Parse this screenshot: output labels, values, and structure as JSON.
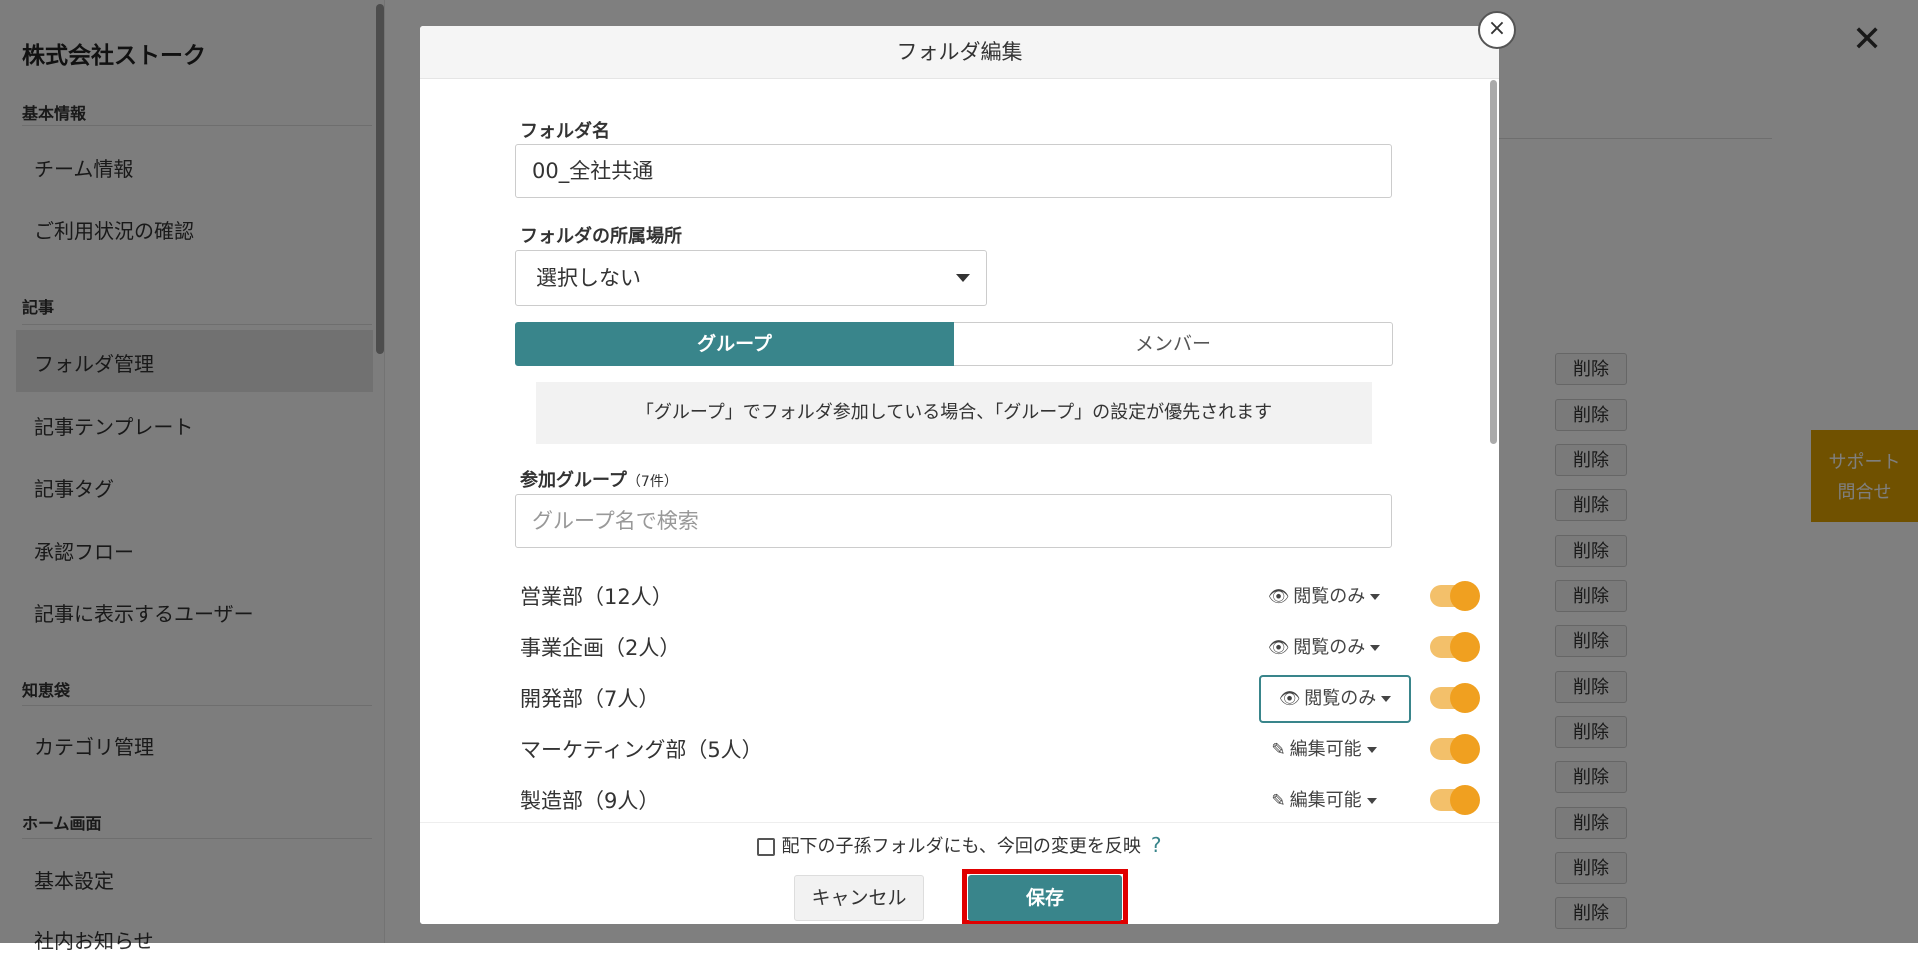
{
  "sidebar": {
    "company": "株式会社ストーク",
    "sections": [
      {
        "heading": "基本情報",
        "items": [
          "チーム情報",
          "ご利用状況の確認"
        ]
      },
      {
        "heading": "記事",
        "items": [
          "フォルダ管理",
          "記事テンプレート",
          "記事タグ",
          "承認フロー",
          "記事に表示するユーザー"
        ]
      },
      {
        "heading": "知恵袋",
        "items": [
          "カテゴリ管理"
        ]
      },
      {
        "heading": "ホーム画面",
        "items": [
          "基本設定",
          "社内お知らせ"
        ]
      }
    ],
    "active_item": "フォルダ管理"
  },
  "background": {
    "close_glyph": "✕",
    "delete_label": "削除",
    "support_line1": "サポート",
    "support_line2": "問合せ"
  },
  "modal": {
    "title": "フォルダ編集",
    "close_glyph": "×",
    "folder_name_label": "フォルダ名",
    "folder_name_value": "00_全社共通",
    "parent_label": "フォルダの所属場所",
    "parent_value": "選択しない",
    "tabs": {
      "group": "グループ",
      "member": "メンバー"
    },
    "notice": "「グループ」でフォルダ参加している場合、「グループ」の設定が優先されます",
    "groups_label": "参加グループ",
    "groups_count": "（7件）",
    "search_placeholder": "グループ名で検索",
    "groups": [
      {
        "name": "営業部（12人）",
        "permission": "閲覧のみ",
        "icon": "eye-icon",
        "enabled": true
      },
      {
        "name": "事業企画（2人）",
        "permission": "閲覧のみ",
        "icon": "eye-icon",
        "enabled": true
      },
      {
        "name": "開発部（7人）",
        "permission": "閲覧のみ",
        "icon": "eye-icon",
        "enabled": true
      },
      {
        "name": "マーケティング部（5人）",
        "permission": "編集可能",
        "icon": "pencil-icon",
        "enabled": true
      },
      {
        "name": "製造部（9人）",
        "permission": "編集可能",
        "icon": "pencil-icon",
        "enabled": true
      }
    ],
    "apply_children_label": "配下の子孫フォルダにも、今回の変更を反映",
    "help_glyph": "?",
    "cancel_label": "キャンセル",
    "save_label": "保存"
  },
  "colors": {
    "accent": "#39858b",
    "toggle": "#f0a020",
    "highlight": "#e00000",
    "support": "#e0a300"
  }
}
